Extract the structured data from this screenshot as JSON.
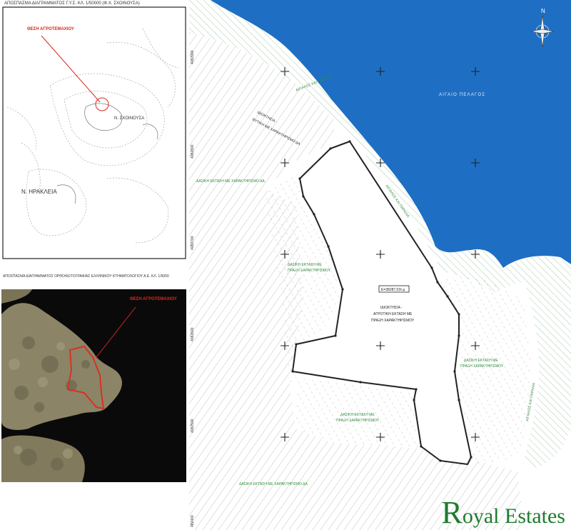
{
  "colors": {
    "sea": "#1e6fc3",
    "frame_red": "#d62a1e",
    "boundary": "#222222",
    "forest_label": "#2e8b3a",
    "logo_green": "#1f7a2e"
  },
  "inset_top": {
    "caption": "ΑΠΟΣΠΑΣΜΑ ΔΙΑΓΡΑΜΜΑΤΟΣ Γ.Υ.Σ. ΚΛ. 1/50000 (Φ.Χ. ΣΧΟΙΝΟΥΣΑ)",
    "site_label": "ΘΕΣΗ ΑΓΡΟΤΕΜΑΧΙΟΥ",
    "island_label_1": "Ν. ΣΧΟΙΝΟΥΣΑ",
    "island_label_2": "Ν. ΗΡΑΚΛΕΙΑ"
  },
  "inset_bottom": {
    "caption": "ΑΠΟΣΠΑΣΜΑ ΔΙΑΓΡΑΜΜΑΤΟΣ ΟΡΘΟΦΩΤΟΓΡΑΦΙΑΣ ΕΛΛΗΝΙΚΟΥ ΚΤΗΜΑΤΟΛΟΓΙΟΥ Α.Ε. ΚΛ. 1/5000",
    "site_label": "ΘΕΣΗ ΑΓΡΟΤΕΜΑΧΙΟΥ"
  },
  "main_map": {
    "sea_label": "ΑΙΓΑΙΟ ΠΕΛΑΓΟΣ",
    "north_label": "N",
    "area_box": "Ε=38287,03τ.μ",
    "parcel_label_1": "ΙΔΙΟΚΤΗΣΙΑ -",
    "parcel_label_2": "ΑΓΡΟΤΙΚΗ ΕΚΤΑΣΗ ΜΕ",
    "parcel_label_3": "ΠΡΑΞΗ ΧΑΡΑΚΤΗΡΙΣΜΟΥ",
    "private_zone_1": "ΙΔΙΟΚΤΗΣΙΑ -",
    "private_zone_2": "ΘΥΤΙΚΗ ΜΕ ΧΑΡΑΚΤΗΡΙΣΜΟ ΔΑ",
    "forest_da": "ΔΑΣΙΚΗ ΕΚΤΑΣΗ ΜΕ ΧΑΡΑΚΤΗΡΙΣΜΟ ΔΑ",
    "forest_praxi_1": "ΔΑΣΙΚΗ ΕΚΤΑΣΗ ΜΕ",
    "forest_praxi_2": "ΠΡΑΞΗ ΧΑΡΑΚΤΗΡΙΣΜΟΥ",
    "coast_label_1": "ΑΙΓΙΑΛΟΣ ΚΑΙ ΠΑΡΑΛΙΑ",
    "coast_label_2": "ΑΙΓΙΑΛΟΣ ΚΑΙ ΠΑΡΑΛΙΑ",
    "coast_label_3": "ΑΙΓΙΑΛΟΣ ΚΑΙ ΠΑΡΑΛΙΑ",
    "coord_1": "4082900",
    "coord_2": "4082800",
    "coord_3": "4082700",
    "coord_4": "4082600",
    "coord_5": "4082500",
    "coord_bottom": "482400"
  },
  "logo": {
    "initial": "R",
    "rest": "oyal Estates"
  }
}
